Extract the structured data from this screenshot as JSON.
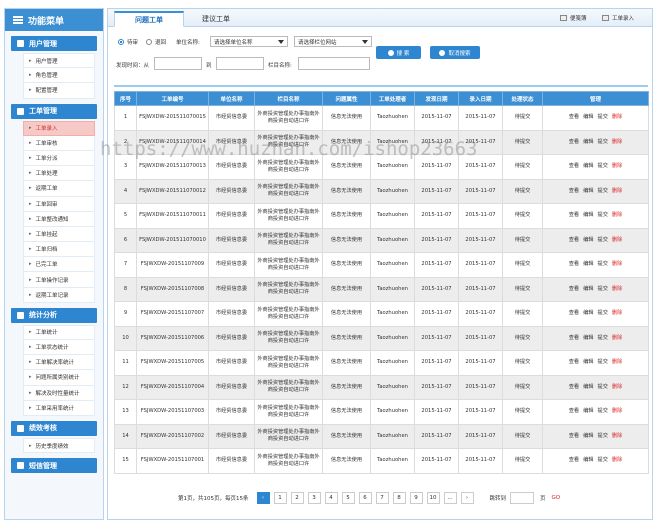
{
  "sidebar": {
    "title": "功能菜单",
    "groups": [
      {
        "title": "用户管理",
        "items": [
          "用户管理",
          "角色管理",
          "配置管理"
        ]
      },
      {
        "title": "工单管理",
        "items": [
          "工单录入",
          "工单审核",
          "工单分派",
          "工单处理",
          "返期工单",
          "工单回审",
          "工单整改通知",
          "工单挂起",
          "工单归档",
          "已完工单",
          "工单操作记录",
          "返期工单记录"
        ]
      },
      {
        "title": "统计分析",
        "items": [
          "工单统计",
          "工单状态统计",
          "工单解决率统计",
          "问题所属类别统计",
          "解决及时性量统计",
          "工单采用率统计"
        ]
      },
      {
        "title": "绩效考核",
        "items": [
          "历史季度绩效"
        ]
      },
      {
        "title": "短信管理",
        "items": []
      }
    ],
    "active_item": "工单录入"
  },
  "tabs": {
    "active": "问题工单",
    "other": "建议工单"
  },
  "toolbar": {
    "notes": "便笺簿",
    "entry": "工单录入"
  },
  "filters": {
    "radio_pending": "待审",
    "radio_return": "退回",
    "unit_label": "单位名称:",
    "unit_select": "请选择单位名称",
    "site_select": "请选择栏位网站",
    "time_label": "发现时间：从",
    "to_label": "到",
    "column_label": "栏目名称:",
    "search_btn": "搜 索",
    "cancel_btn": "取消搜索"
  },
  "table": {
    "headers": [
      "序号",
      "工单编号",
      "单位名称",
      "栏目名称",
      "问题属性",
      "工单处理者",
      "发现日期",
      "录入日期",
      "处理状态",
      "管理"
    ],
    "rows": [
      {
        "no": "1",
        "id": "FSJWXDW-201511070015",
        "unit": "市经贸信息委",
        "column": "外商投资管理处办事指南外商投资自动进口许",
        "attr": "信息无法使用",
        "handler": "Taozhuohen",
        "found": "2015-11-07",
        "entry": "2015-11-07",
        "status": "待提交"
      },
      {
        "no": "2",
        "id": "FSJWXDW-201511070014",
        "unit": "市经贸信息委",
        "column": "外商投资管理处办事指南外商投资自动进口许",
        "attr": "信息无法使用",
        "handler": "Taozhuohen",
        "found": "2015-11-07",
        "entry": "2015-11-07",
        "status": "待提交"
      },
      {
        "no": "3",
        "id": "FSJWXDW-201511070013",
        "unit": "市经贸信息委",
        "column": "外商投资管理处办事指南外商投资自动进口许",
        "attr": "信息无法使用",
        "handler": "Taozhuohen",
        "found": "2015-11-07",
        "entry": "2015-11-07",
        "status": "待提交"
      },
      {
        "no": "4",
        "id": "FSJWXDW-201511070012",
        "unit": "市经贸信息委",
        "column": "外商投资管理处办事指南外商投资自动进口许",
        "attr": "信息无法使用",
        "handler": "Taozhuohen",
        "found": "2015-11-07",
        "entry": "2015-11-07",
        "status": "待提交"
      },
      {
        "no": "5",
        "id": "FSJWXDW-201511070011",
        "unit": "市经贸信息委",
        "column": "外商投资管理处办事指南外商投资自动进口许",
        "attr": "信息无法使用",
        "handler": "Taozhuohen",
        "found": "2015-11-07",
        "entry": "2015-11-07",
        "status": "待提交"
      },
      {
        "no": "6",
        "id": "FSJWXDW-201511070010",
        "unit": "市经贸信息委",
        "column": "外商投资管理处办事指南外商投资自动进口许",
        "attr": "信息无法使用",
        "handler": "Taozhuohen",
        "found": "2015-11-07",
        "entry": "2015-11-07",
        "status": "待提交"
      },
      {
        "no": "7",
        "id": "FSJWXDW-20151107009",
        "unit": "市经贸信息委",
        "column": "外商投资管理处办事指南外商投资自动进口许",
        "attr": "信息无法使用",
        "handler": "Taozhuohen",
        "found": "2015-11-07",
        "entry": "2015-11-07",
        "status": "待提交"
      },
      {
        "no": "8",
        "id": "FSJWXDW-20151107008",
        "unit": "市经贸信息委",
        "column": "外商投资管理处办事指南外商投资自动进口许",
        "attr": "信息无法使用",
        "handler": "Taozhuohen",
        "found": "2015-11-07",
        "entry": "2015-11-07",
        "status": "待提交"
      },
      {
        "no": "9",
        "id": "FSJWXDW-20151107007",
        "unit": "市经贸信息委",
        "column": "外商投资管理处办事指南外商投资自动进口许",
        "attr": "信息无法使用",
        "handler": "Taozhuohen",
        "found": "2015-11-07",
        "entry": "2015-11-07",
        "status": "待提交"
      },
      {
        "no": "10",
        "id": "FSJWXDW-20151107006",
        "unit": "市经贸信息委",
        "column": "外商投资管理处办事指南外商投资自动进口许",
        "attr": "信息无法使用",
        "handler": "Taozhuohen",
        "found": "2015-11-07",
        "entry": "2015-11-07",
        "status": "待提交"
      },
      {
        "no": "11",
        "id": "FSJWXDW-20151107005",
        "unit": "市经贸信息委",
        "column": "外商投资管理处办事指南外商投资自动进口许",
        "attr": "信息无法使用",
        "handler": "Taozhuohen",
        "found": "2015-11-07",
        "entry": "2015-11-07",
        "status": "待提交"
      },
      {
        "no": "12",
        "id": "FSJWXDW-20151107004",
        "unit": "市经贸信息委",
        "column": "外商投资管理处办事指南外商投资自动进口许",
        "attr": "信息无法使用",
        "handler": "Taozhuohen",
        "found": "2015-11-07",
        "entry": "2015-11-07",
        "status": "待提交"
      },
      {
        "no": "13",
        "id": "FSJWXDW-20151107003",
        "unit": "市经贸信息委",
        "column": "外商投资管理处办事指南外商投资自动进口许",
        "attr": "信息无法使用",
        "handler": "Taozhuohen",
        "found": "2015-11-07",
        "entry": "2015-11-07",
        "status": "待提交"
      },
      {
        "no": "14",
        "id": "FSJWXDW-20151107002",
        "unit": "市经贸信息委",
        "column": "外商投资管理处办事指南外商投资自动进口许",
        "attr": "信息无法使用",
        "handler": "Taozhuohen",
        "found": "2015-11-07",
        "entry": "2015-11-07",
        "status": "待提交"
      },
      {
        "no": "15",
        "id": "FSJWXDW-20151107001",
        "unit": "市经贸信息委",
        "column": "外商投资管理处办事指南外商投资自动进口许",
        "attr": "信息无法使用",
        "handler": "Taozhuohen",
        "found": "2015-11-07",
        "entry": "2015-11-07",
        "status": "待提交"
      }
    ],
    "ops": {
      "view": "查看",
      "edit": "编辑",
      "submit": "提交",
      "delete": "删除"
    }
  },
  "pager": {
    "summary": "第1页，共105页，每页15条",
    "prev": "‹",
    "pages": [
      "1",
      "2",
      "3",
      "4",
      "5",
      "6",
      "7",
      "8",
      "9",
      "10",
      "..."
    ],
    "next": "›",
    "jump_label": "跳转到",
    "page_unit": "页",
    "go": "GO"
  },
  "watermark": "https://www.huzhan.com/ishop23663",
  "colors": {
    "primary": "#2e86d0",
    "header": "#3d8fd3",
    "delete": "#dd2222",
    "active_bg": "#f6c9c6"
  }
}
